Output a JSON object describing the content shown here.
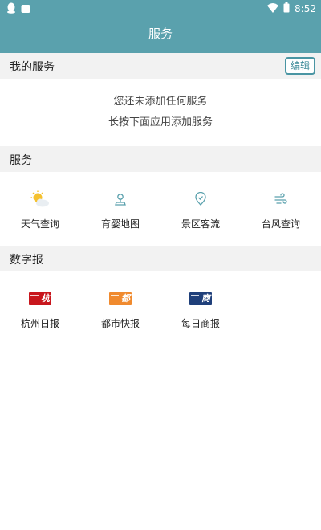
{
  "status_bar": {
    "time": "8:52",
    "left_icons": [
      "penguin-icon",
      "briefcase-icon"
    ],
    "right_icons": [
      "wifi-icon",
      "battery-icon"
    ]
  },
  "app_bar": {
    "title": "服务"
  },
  "my_services": {
    "title": "我的服务",
    "edit_label": "编辑",
    "empty_line1": "您还未添加任何服务",
    "empty_line2": "长按下面应用添加服务"
  },
  "services": {
    "title": "服务",
    "items": [
      {
        "label": "天气查询",
        "icon": "weather-sun-cloud-icon"
      },
      {
        "label": "育婴地图",
        "icon": "map-pin-icon"
      },
      {
        "label": "景区客流",
        "icon": "location-shield-icon"
      },
      {
        "label": "台风查询",
        "icon": "wind-icon"
      }
    ]
  },
  "digital_papers": {
    "title": "数字报",
    "items": [
      {
        "label": "杭州日报",
        "icon": "hangzhou-daily-logo",
        "color": "#c8161d"
      },
      {
        "label": "都市快报",
        "icon": "city-express-logo",
        "color": "#f08a2e"
      },
      {
        "label": "每日商报",
        "icon": "daily-business-logo",
        "color": "#1f3f7a"
      }
    ]
  },
  "colors": {
    "primary": "#5aa1ad",
    "accent": "#4a95a3",
    "section_bg": "#f2f2f2"
  }
}
